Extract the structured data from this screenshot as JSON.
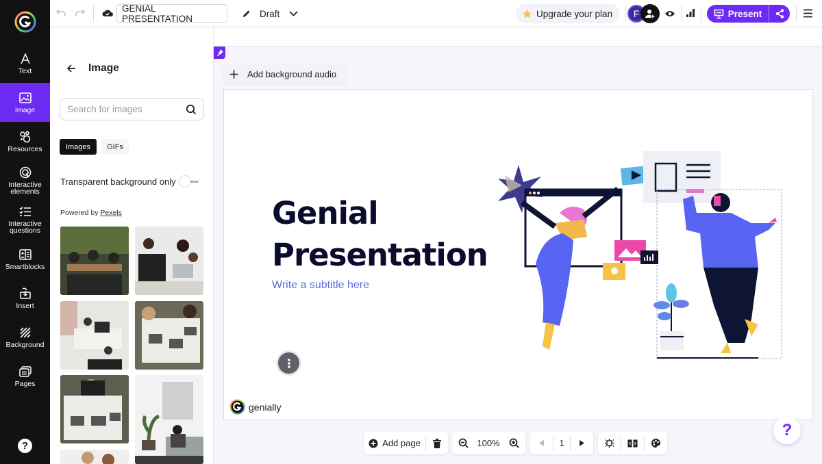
{
  "app": {
    "presentation_title": "GENIAL PRESENTATION",
    "status_label": "Draft",
    "upgrade_label": "Upgrade your plan",
    "avatar_initial": "F",
    "present_label": "Present"
  },
  "rail": {
    "items": [
      {
        "label": "Text",
        "icon": "text-icon"
      },
      {
        "label": "Image",
        "icon": "image-icon"
      },
      {
        "label": "Resources",
        "icon": "resources-icon"
      },
      {
        "label": "Interactive elements",
        "icon": "interactive-elements-icon"
      },
      {
        "label": "Interactive questions",
        "icon": "interactive-questions-icon"
      },
      {
        "label": "Smartblocks",
        "icon": "smartblocks-icon"
      },
      {
        "label": "Insert",
        "icon": "insert-icon"
      },
      {
        "label": "Background",
        "icon": "background-icon"
      },
      {
        "label": "Pages",
        "icon": "pages-icon"
      }
    ],
    "active": "Image",
    "help_label": "?"
  },
  "panel": {
    "title": "Image",
    "search_placeholder": "Search for images",
    "tabs": [
      {
        "label": "Images",
        "active": true
      },
      {
        "label": "GIFs",
        "active": false
      }
    ],
    "transparent_label": "Transparent background only",
    "transparent_on": false,
    "powered_by": "Powered by",
    "powered_link": "Pexels"
  },
  "canvas": {
    "audio_label": "Add background audio",
    "slide_title_line1": "Genial",
    "slide_title_line2": "Presentation",
    "slide_subtitle": "Write a subtitle here",
    "brand_label": "genially"
  },
  "bottom": {
    "add_page_label": "Add page",
    "zoom_label": "100%",
    "page_number": "1"
  },
  "colors": {
    "accent": "#6d2af2",
    "rail_bg": "#121212",
    "title_color": "#0b0b2e",
    "subtitle_color": "#5a6cdc"
  }
}
